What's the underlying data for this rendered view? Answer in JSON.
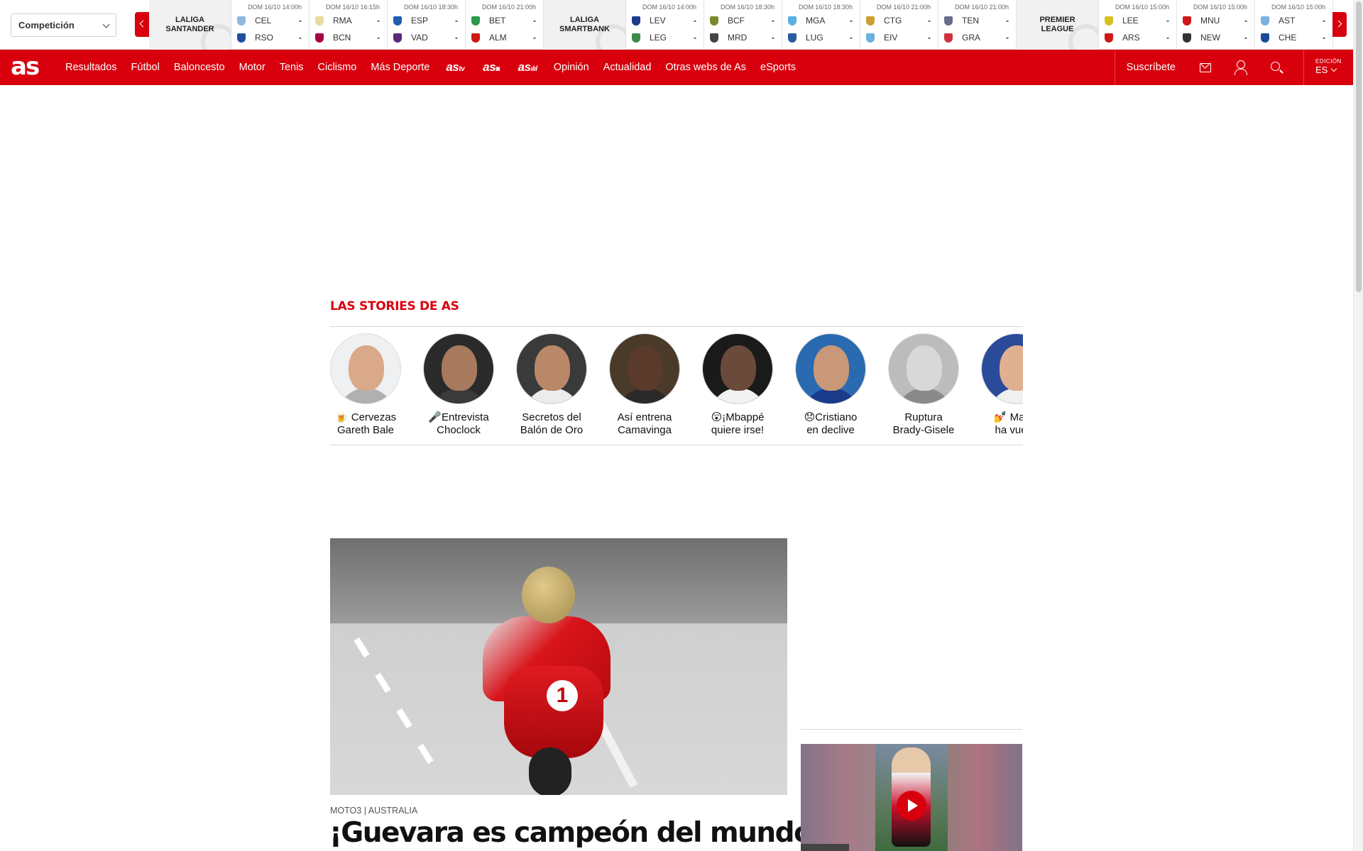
{
  "scoreboard": {
    "competition_select": "Competición",
    "leagues": [
      {
        "name_line1": "LALIGA",
        "name_line2": "SANTANDER",
        "matches": [
          {
            "date": "DOM 16/10 14:00h",
            "home": "CEL",
            "away": "RSO",
            "home_score": "-",
            "away_score": "-",
            "home_color": "#8fb8de",
            "away_color": "#1f4fa0"
          },
          {
            "date": "DOM 16/10 16:15h",
            "home": "RMA",
            "away": "BCN",
            "home_score": "-",
            "away_score": "-",
            "home_color": "#e8d9a0",
            "away_color": "#a50044"
          },
          {
            "date": "DOM 16/10 18:30h",
            "home": "ESP",
            "away": "VAD",
            "home_score": "-",
            "away_score": "-",
            "home_color": "#1f5fb0",
            "away_color": "#5a2a7a"
          },
          {
            "date": "DOM 16/10 21:00h",
            "home": "BET",
            "away": "ALM",
            "home_score": "-",
            "away_score": "-",
            "home_color": "#2a9a4a",
            "away_color": "#d01818"
          }
        ]
      },
      {
        "name_line1": "LALIGA",
        "name_line2": "SMARTBANK",
        "matches": [
          {
            "date": "DOM 16/10 14:00h",
            "home": "LEV",
            "away": "LEG",
            "home_score": "-",
            "away_score": "-",
            "home_color": "#1a3a8a",
            "away_color": "#3a8a4a"
          },
          {
            "date": "DOM 16/10 18:30h",
            "home": "BCF",
            "away": "MRD",
            "home_score": "-",
            "away_score": "-",
            "home_color": "#7a8a2a",
            "away_color": "#444444"
          },
          {
            "date": "DOM 16/10 18:30h",
            "home": "MGA",
            "away": "LUG",
            "home_score": "-",
            "away_score": "-",
            "home_color": "#5ab0e0",
            "away_color": "#2a5aa0"
          },
          {
            "date": "DOM 16/10 21:00h",
            "home": "CTG",
            "away": "EIV",
            "home_score": "-",
            "away_score": "-",
            "home_color": "#caa030",
            "away_color": "#6ab0e0"
          },
          {
            "date": "DOM 16/10 21:00h",
            "home": "TEN",
            "away": "GRA",
            "home_score": "-",
            "away_score": "-",
            "home_color": "#6a6a8a",
            "away_color": "#d0303a"
          }
        ]
      },
      {
        "name_line1": "PREMIER",
        "name_line2": "LEAGUE",
        "matches": [
          {
            "date": "DOM 16/10 15:00h",
            "home": "LEE",
            "away": "ARS",
            "home_score": "-",
            "away_score": "-",
            "home_color": "#d8c020",
            "away_color": "#d01818"
          },
          {
            "date": "DOM 16/10 15:00h",
            "home": "MNU",
            "away": "NEW",
            "home_score": "-",
            "away_score": "-",
            "home_color": "#d01818",
            "away_color": "#333333"
          },
          {
            "date": "DOM 16/10 15:00h",
            "home": "AST",
            "away": "CHE",
            "home_score": "-",
            "away_score": "-",
            "home_color": "#7ab0e0",
            "away_color": "#1a4a9a"
          }
        ]
      }
    ]
  },
  "nav": {
    "logo": "as",
    "links": [
      "Resultados",
      "Fútbol",
      "Baloncesto",
      "Motor",
      "Tenis",
      "Ciclismo",
      "Más Deporte"
    ],
    "media": [
      {
        "main": "as",
        "tag": "tv"
      },
      {
        "main": "as",
        "tag": "◙"
      },
      {
        "main": "as",
        "tag": "ılıl"
      }
    ],
    "links2": [
      "Opinión",
      "Actualidad",
      "Otras webs de As",
      "eSports"
    ],
    "subscribe": "Suscríbete",
    "edition_label": "EDICIÓN",
    "edition_value": "ES"
  },
  "stories": {
    "heading": "LAS STORIES DE AS",
    "items": [
      {
        "title_line1": "🍺 Cervezas",
        "title_line2": "Gareth Bale",
        "skin": "#d9a98a",
        "shirt": "#b0b0b0",
        "bg": "#eef0f2"
      },
      {
        "title_line1": "🎤Entrevista",
        "title_line2": "Choclock",
        "skin": "#a77a5e",
        "shirt": "#3a3a3a",
        "bg": "#2a2a2a"
      },
      {
        "title_line1": "Secretos del",
        "title_line2": "Balón de Oro",
        "skin": "#b98868",
        "shirt": "#ececec",
        "bg": "#3a3a3a"
      },
      {
        "title_line1": "Así entrena",
        "title_line2": "Camavinga",
        "skin": "#5a3a2a",
        "shirt": "#2a2a2a",
        "bg": "#4a3a2a"
      },
      {
        "title_line1": "😲¡Mbappé",
        "title_line2": "quiere irse!",
        "skin": "#6a4a3a",
        "shirt": "#f2f2f2",
        "bg": "#1a1a1a"
      },
      {
        "title_line1": "😞Cristiano",
        "title_line2": "en declive",
        "skin": "#c89878",
        "shirt": "#1a3a8a",
        "bg": "#2a6ab0"
      },
      {
        "title_line1": "Ruptura",
        "title_line2": "Brady-Gisele",
        "skin": "#d8d8d8",
        "shirt": "#8a8a8a",
        "bg": "#bcbcbc"
      },
      {
        "title_line1": "💅 Marco",
        "title_line2": "ha vuelto",
        "skin": "#e0b090",
        "shirt": "#f0f0f0",
        "bg": "#2a4a9a"
      }
    ]
  },
  "lead": {
    "kicker": "MOTO3 | AUSTRALIA",
    "headline": "¡Guevara es campeón del mundo!",
    "bike_number": "1"
  },
  "video": {
    "play_label": "play"
  }
}
